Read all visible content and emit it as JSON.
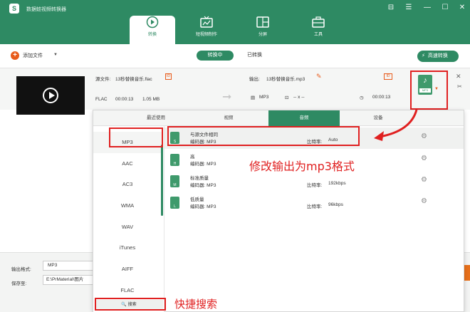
{
  "header": {
    "app_title": "数据蛙视频转换器",
    "logo_glyph": "S",
    "window_controls": [
      "⊟",
      "☰",
      "—",
      "☐",
      "✕"
    ],
    "nav_tabs": [
      {
        "label": "转换",
        "icon": "convert-icon"
      },
      {
        "label": "短视频制作",
        "icon": "tv-icon"
      },
      {
        "label": "分屏",
        "icon": "split-screen-icon"
      },
      {
        "label": "工具",
        "icon": "toolbox-icon"
      }
    ]
  },
  "toolbar": {
    "add_file_label": "添加文件",
    "add_plus_glyph": "+",
    "caret_glyph": "▼",
    "subtabs": [
      "转换中",
      "已转换"
    ],
    "high_speed_label": "高速转换",
    "high_speed_glyph": "⚡"
  },
  "file_row": {
    "source_label": "源文件:",
    "source_name": "13秒替换音乐.flac",
    "source_format": "FLAC",
    "source_duration": "00:00:13",
    "source_size": "1.05 MB",
    "output_label": "输出:",
    "output_name": "13秒替换音乐.mp3",
    "output_format": "MP3",
    "output_size": "-- x --",
    "output_duration": "00:00:13",
    "format_tag": "MP3",
    "note_glyph": "♪",
    "arrow_glyph": "➞",
    "edit_glyph": "✎",
    "info_glyph": "ID",
    "close_glyph": "✕",
    "cut_glyph": "✂"
  },
  "bottom": {
    "output_format_label": "输出格式:",
    "output_format_value": "MP3",
    "save_to_label": "保存至:",
    "save_to_value": "E:\\PrMaterial\\图片"
  },
  "popup": {
    "tabs": [
      "最近使用",
      "视频",
      "音频",
      "设备"
    ],
    "formats": [
      "MP3",
      "AAC",
      "AC3",
      "WMA",
      "WAV",
      "iTunes",
      "AIFF",
      "FLAC"
    ],
    "search_label": "搜索",
    "search_glyph": "🔍",
    "presets": [
      {
        "name": "与源文件相同",
        "encoder": "编码器: MP3",
        "bitrate_label": "比特率:",
        "bitrate": "Auto",
        "badge": "S"
      },
      {
        "name": "高",
        "encoder": "编码器: MP3",
        "bitrate_label": "",
        "bitrate": "",
        "badge": "H"
      },
      {
        "name": "标准质量",
        "encoder": "编码器: MP3",
        "bitrate_label": "比特率:",
        "bitrate": "192kbps",
        "badge": "M"
      },
      {
        "name": "低质量",
        "encoder": "编码器: MP3",
        "bitrate_label": "比特率:",
        "bitrate": "96kbps",
        "badge": "L"
      }
    ],
    "gear_glyph": "⚙"
  },
  "annotations": {
    "main_text": "修改输出为mp3格式",
    "search_text": "快捷搜索",
    "color": "#e02020"
  },
  "colors": {
    "brand_green": "#2e8a63",
    "accent_orange": "#e85b1b"
  }
}
